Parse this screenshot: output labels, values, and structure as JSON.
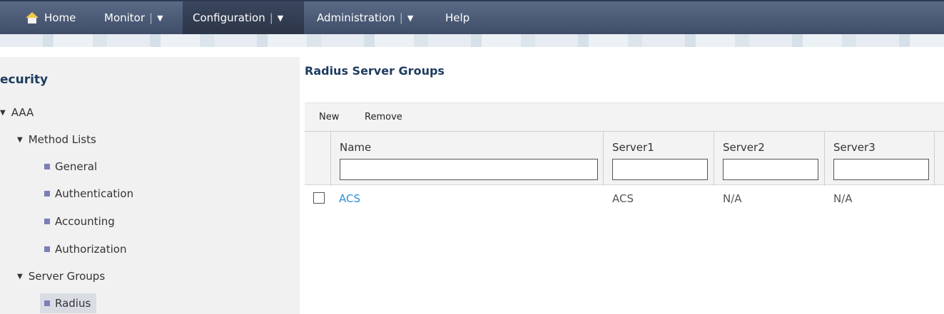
{
  "nav": {
    "home": "Home",
    "monitor": "Monitor",
    "configuration": "Configuration",
    "administration": "Administration",
    "help": "Help",
    "separator": "|",
    "caret": "▼"
  },
  "sidebar": {
    "title": "ecurity",
    "aaa": "AAA",
    "method_lists": "Method Lists",
    "general": "General",
    "authentication": "Authentication",
    "accounting": "Accounting",
    "authorization": "Authorization",
    "server_groups": "Server Groups",
    "radius": "Radius"
  },
  "main": {
    "title": "Radius Server Groups",
    "toolbar": {
      "new": "New",
      "remove": "Remove"
    },
    "columns": [
      "Name",
      "Server1",
      "Server2",
      "Server3"
    ],
    "filters": [
      "",
      "",
      "",
      ""
    ],
    "rows": [
      {
        "name": "ACS",
        "server1": "ACS",
        "server2": "N/A",
        "server3": "N/A"
      }
    ]
  }
}
